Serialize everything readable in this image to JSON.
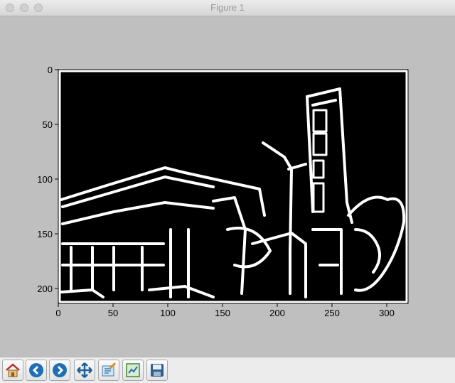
{
  "window": {
    "title": "Figure 1"
  },
  "plot": {
    "x_ticks": [
      "0",
      "50",
      "100",
      "150",
      "200",
      "250",
      "300"
    ],
    "y_ticks": [
      "0",
      "50",
      "100",
      "150",
      "200"
    ]
  },
  "toolbar": {
    "buttons": [
      "home-icon",
      "back-arrow-icon",
      "forward-arrow-icon",
      "pan-arrows-icon",
      "subplots-config-icon",
      "zoom-rect-icon",
      "save-disk-icon"
    ]
  }
}
